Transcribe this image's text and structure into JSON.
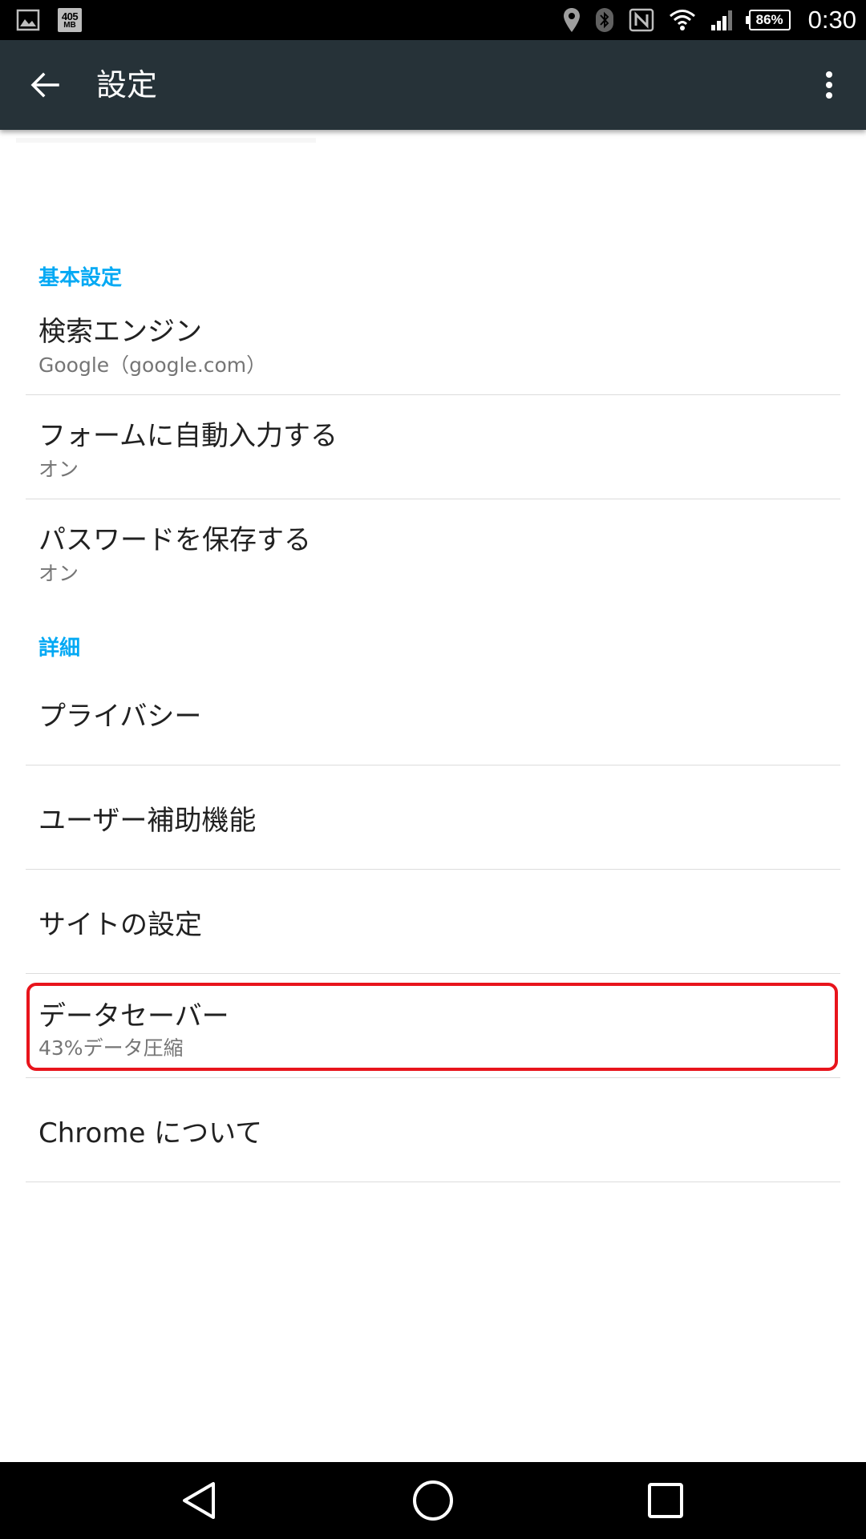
{
  "status_bar": {
    "data_usage_number": "405",
    "data_usage_unit": "MB",
    "battery_percent": "86%",
    "time": "0:30",
    "icons": [
      "image-icon",
      "data-usage-icon",
      "location-icon",
      "bluetooth-icon",
      "nfc-icon",
      "wifi-icon",
      "cell-signal-icon",
      "battery-icon"
    ]
  },
  "toolbar": {
    "title": "設定",
    "background": "#263238"
  },
  "sections": {
    "basic": {
      "header": "基本設定",
      "items": [
        {
          "title": "検索エンジン",
          "subtitle": "Google（google.com）"
        },
        {
          "title": "フォームに自動入力する",
          "subtitle": "オン"
        },
        {
          "title": "パスワードを保存する",
          "subtitle": "オン"
        }
      ]
    },
    "advanced": {
      "header": "詳細",
      "items": [
        {
          "title": "プライバシー"
        },
        {
          "title": "ユーザー補助機能"
        },
        {
          "title": "サイトの設定"
        },
        {
          "title": "データセーバー",
          "subtitle": "43%データ圧縮"
        },
        {
          "title": "Chrome について"
        }
      ]
    }
  },
  "colors": {
    "section_header": "#03a9f4",
    "highlight": "#e8141c"
  },
  "nav_bar": {
    "icons": [
      "back-triangle-icon",
      "home-circle-icon",
      "recents-square-icon"
    ]
  }
}
